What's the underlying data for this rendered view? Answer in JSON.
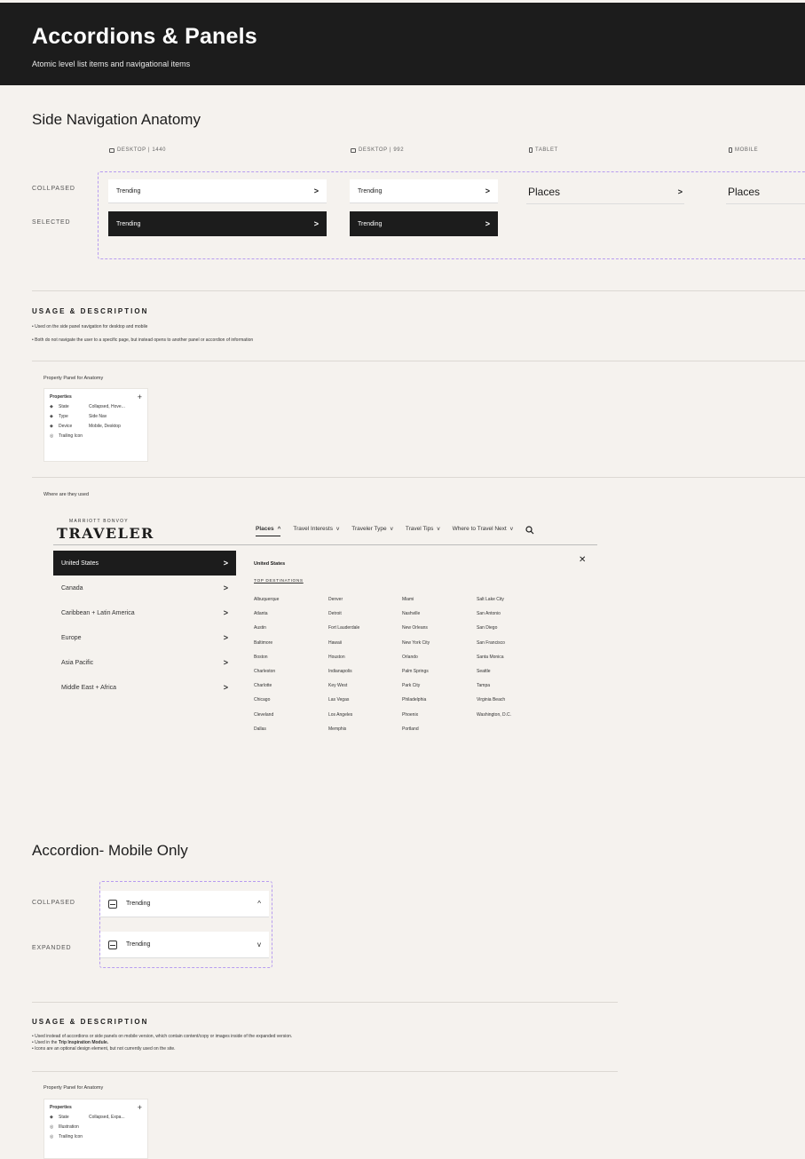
{
  "header": {
    "title": "Accordions & Panels",
    "subtitle": "Atomic level list items and navigational items"
  },
  "side_nav": {
    "title": "Side Navigation Anatomy",
    "columns": [
      {
        "label": "DESKTOP | 1440",
        "icon": "monitor-icon"
      },
      {
        "label": "DESKTOP | 992",
        "icon": "monitor-icon"
      },
      {
        "label": "TABLET",
        "icon": "tablet-icon"
      },
      {
        "label": "MOBILE",
        "icon": "mobile-icon"
      }
    ],
    "rows": {
      "collapsed": "COLLPASED",
      "selected": "SELECTED"
    },
    "items": {
      "desktop_label": "Trending",
      "tablet_label": "Places",
      "mobile_label": "Places",
      "chevron": ">"
    }
  },
  "usage1": {
    "title": "USAGE & DESCRIPTION",
    "bullets": [
      "• Used on the side panel navigation for desktop and mobile",
      "• Both do not navigate the user to a specific page, but instead opens to another panel or accordion of information"
    ]
  },
  "property_panel1": {
    "caption": "Property Panel for Anatomy",
    "heading": "Properties",
    "add": "+",
    "rows": [
      {
        "icon": "◆",
        "name": "State",
        "value": "Collapsed, Hove..."
      },
      {
        "icon": "◆",
        "name": "Type",
        "value": "Side Nav"
      },
      {
        "icon": "◆",
        "name": "Device",
        "value": "Mobile, Desktop"
      },
      {
        "icon": "◎",
        "name": "Trailing Icon",
        "value": ""
      }
    ]
  },
  "where_used": {
    "caption": "Where are they used",
    "brand_top": "MARRIOTT BONVOY",
    "brand": "TRAVELER",
    "menu": [
      {
        "label": "Places",
        "chev": "^"
      },
      {
        "label": "Travel Interests",
        "chev": "v"
      },
      {
        "label": "Traveler Type",
        "chev": "v"
      },
      {
        "label": "Travel Tips",
        "chev": "v"
      },
      {
        "label": "Where to Travel Next",
        "chev": "v"
      }
    ],
    "regions": [
      "United States",
      "Canada",
      "Caribbean + Latin America",
      "Europe",
      "Asia Pacific",
      "Middle East + Africa"
    ],
    "region_chev": ">",
    "panel_title": "United States",
    "close": "✕",
    "destinations_label": "TOP DESTINATIONS",
    "destinations": [
      [
        "Albuquerque",
        "Atlanta",
        "Austin",
        "Baltimore",
        "Boston",
        "Charleston",
        "Charlotte",
        "Chicago",
        "Cleveland",
        "Dallas"
      ],
      [
        "Denver",
        "Detroit",
        "Fort Lauderdale",
        "Hawaii",
        "Houston",
        "Indianapolis",
        "Key West",
        "Las Vegas",
        "Los Angeles",
        "Memphis"
      ],
      [
        "Miami",
        "Nashville",
        "New Orleans",
        "New York City",
        "Orlando",
        "Palm Springs",
        "Park City",
        "Philadelphia",
        "Phoenix",
        "Portland"
      ],
      [
        "Salt Lake City",
        "San Antonio",
        "San Diego",
        "San Francisco",
        "Santa Monica",
        "Seattle",
        "Tampa",
        "Virginia Beach",
        "Washington, D.C."
      ]
    ]
  },
  "accordion": {
    "title": "Accordion- Mobile Only",
    "rows": {
      "collapsed": "COLLPASED",
      "expanded": "EXPANDED"
    },
    "item_label": "Trending",
    "chev_up": "^",
    "chev_down": "v"
  },
  "usage2": {
    "title": "USAGE & DESCRIPTION",
    "bullet1": "• Used instead of accordions or side panels on mobile version, which contain content/copy or images inside of the expanded version.",
    "bullet2_prefix": "• Used in the ",
    "bullet2_bold": "Trip Inspiration Module.",
    "bullet3": "• Icons are an optional design element, but not currently used on the site."
  },
  "property_panel2": {
    "caption": "Property Panel for Anatomy",
    "heading": "Properties",
    "add": "+",
    "rows": [
      {
        "icon": "◆",
        "name": "State",
        "value": "Collapsed, Expa..."
      },
      {
        "icon": "◎",
        "name": "Illustration",
        "value": ""
      },
      {
        "icon": "◎",
        "name": "Trailing Icon",
        "value": ""
      }
    ]
  }
}
